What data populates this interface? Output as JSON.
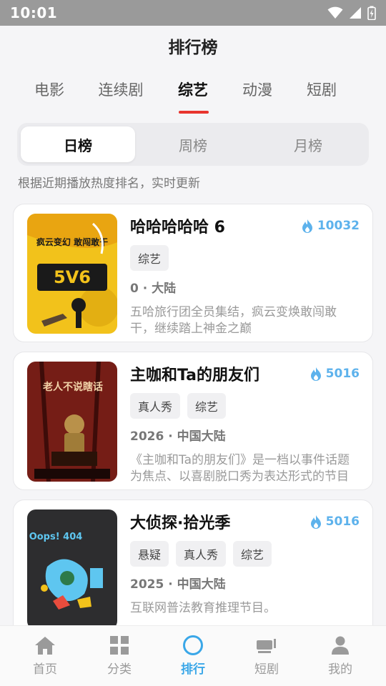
{
  "status_bar": {
    "time": "10:01"
  },
  "header": {
    "title": "排行榜"
  },
  "categories": [
    {
      "label": "电影",
      "active": false
    },
    {
      "label": "连续剧",
      "active": false
    },
    {
      "label": "综艺",
      "active": true
    },
    {
      "label": "动漫",
      "active": false
    },
    {
      "label": "短剧",
      "active": false
    }
  ],
  "periods": [
    {
      "label": "日榜",
      "active": true
    },
    {
      "label": "周榜",
      "active": false
    },
    {
      "label": "月榜",
      "active": false
    }
  ],
  "hint": "根据近期播放热度排名，实时更新",
  "items": [
    {
      "title": "哈哈哈哈哈 6",
      "heat": "10032",
      "tags": [
        "综艺"
      ],
      "meta": "0 · 大陆",
      "description": "五哈旅行团全员集结，疯云变焕敢闯敢干，继续踏上神金之巅",
      "poster_text": "疯云变幻 敢闯敢干"
    },
    {
      "title": "主咖和Ta的朋友们",
      "heat": "5016",
      "tags": [
        "真人秀",
        "综艺"
      ],
      "meta": "2026 · 中国大陆",
      "description": "《主咖和Ta的朋友们》是一档以事件话题为焦点、以喜剧脱口秀为表达形式的节目",
      "poster_text": "老人不说瞎话"
    },
    {
      "title": "大侦探·拾光季",
      "heat": "5016",
      "tags": [
        "悬疑",
        "真人秀",
        "综艺"
      ],
      "meta": "2025 · 中国大陆",
      "description": "互联网普法教育推理节目。",
      "poster_text": "Oops! 404"
    }
  ],
  "nav": [
    {
      "label": "首页",
      "icon": "home-icon",
      "active": false
    },
    {
      "label": "分类",
      "icon": "grid-icon",
      "active": false
    },
    {
      "label": "排行",
      "icon": "ranking-icon",
      "active": true
    },
    {
      "label": "短剧",
      "icon": "short-drama-icon",
      "active": false
    },
    {
      "label": "我的",
      "icon": "profile-icon",
      "active": false
    }
  ],
  "colors": {
    "accent": "#3aa7e8",
    "heat": "#5db2ec",
    "tab_underline": "#e8352e"
  }
}
